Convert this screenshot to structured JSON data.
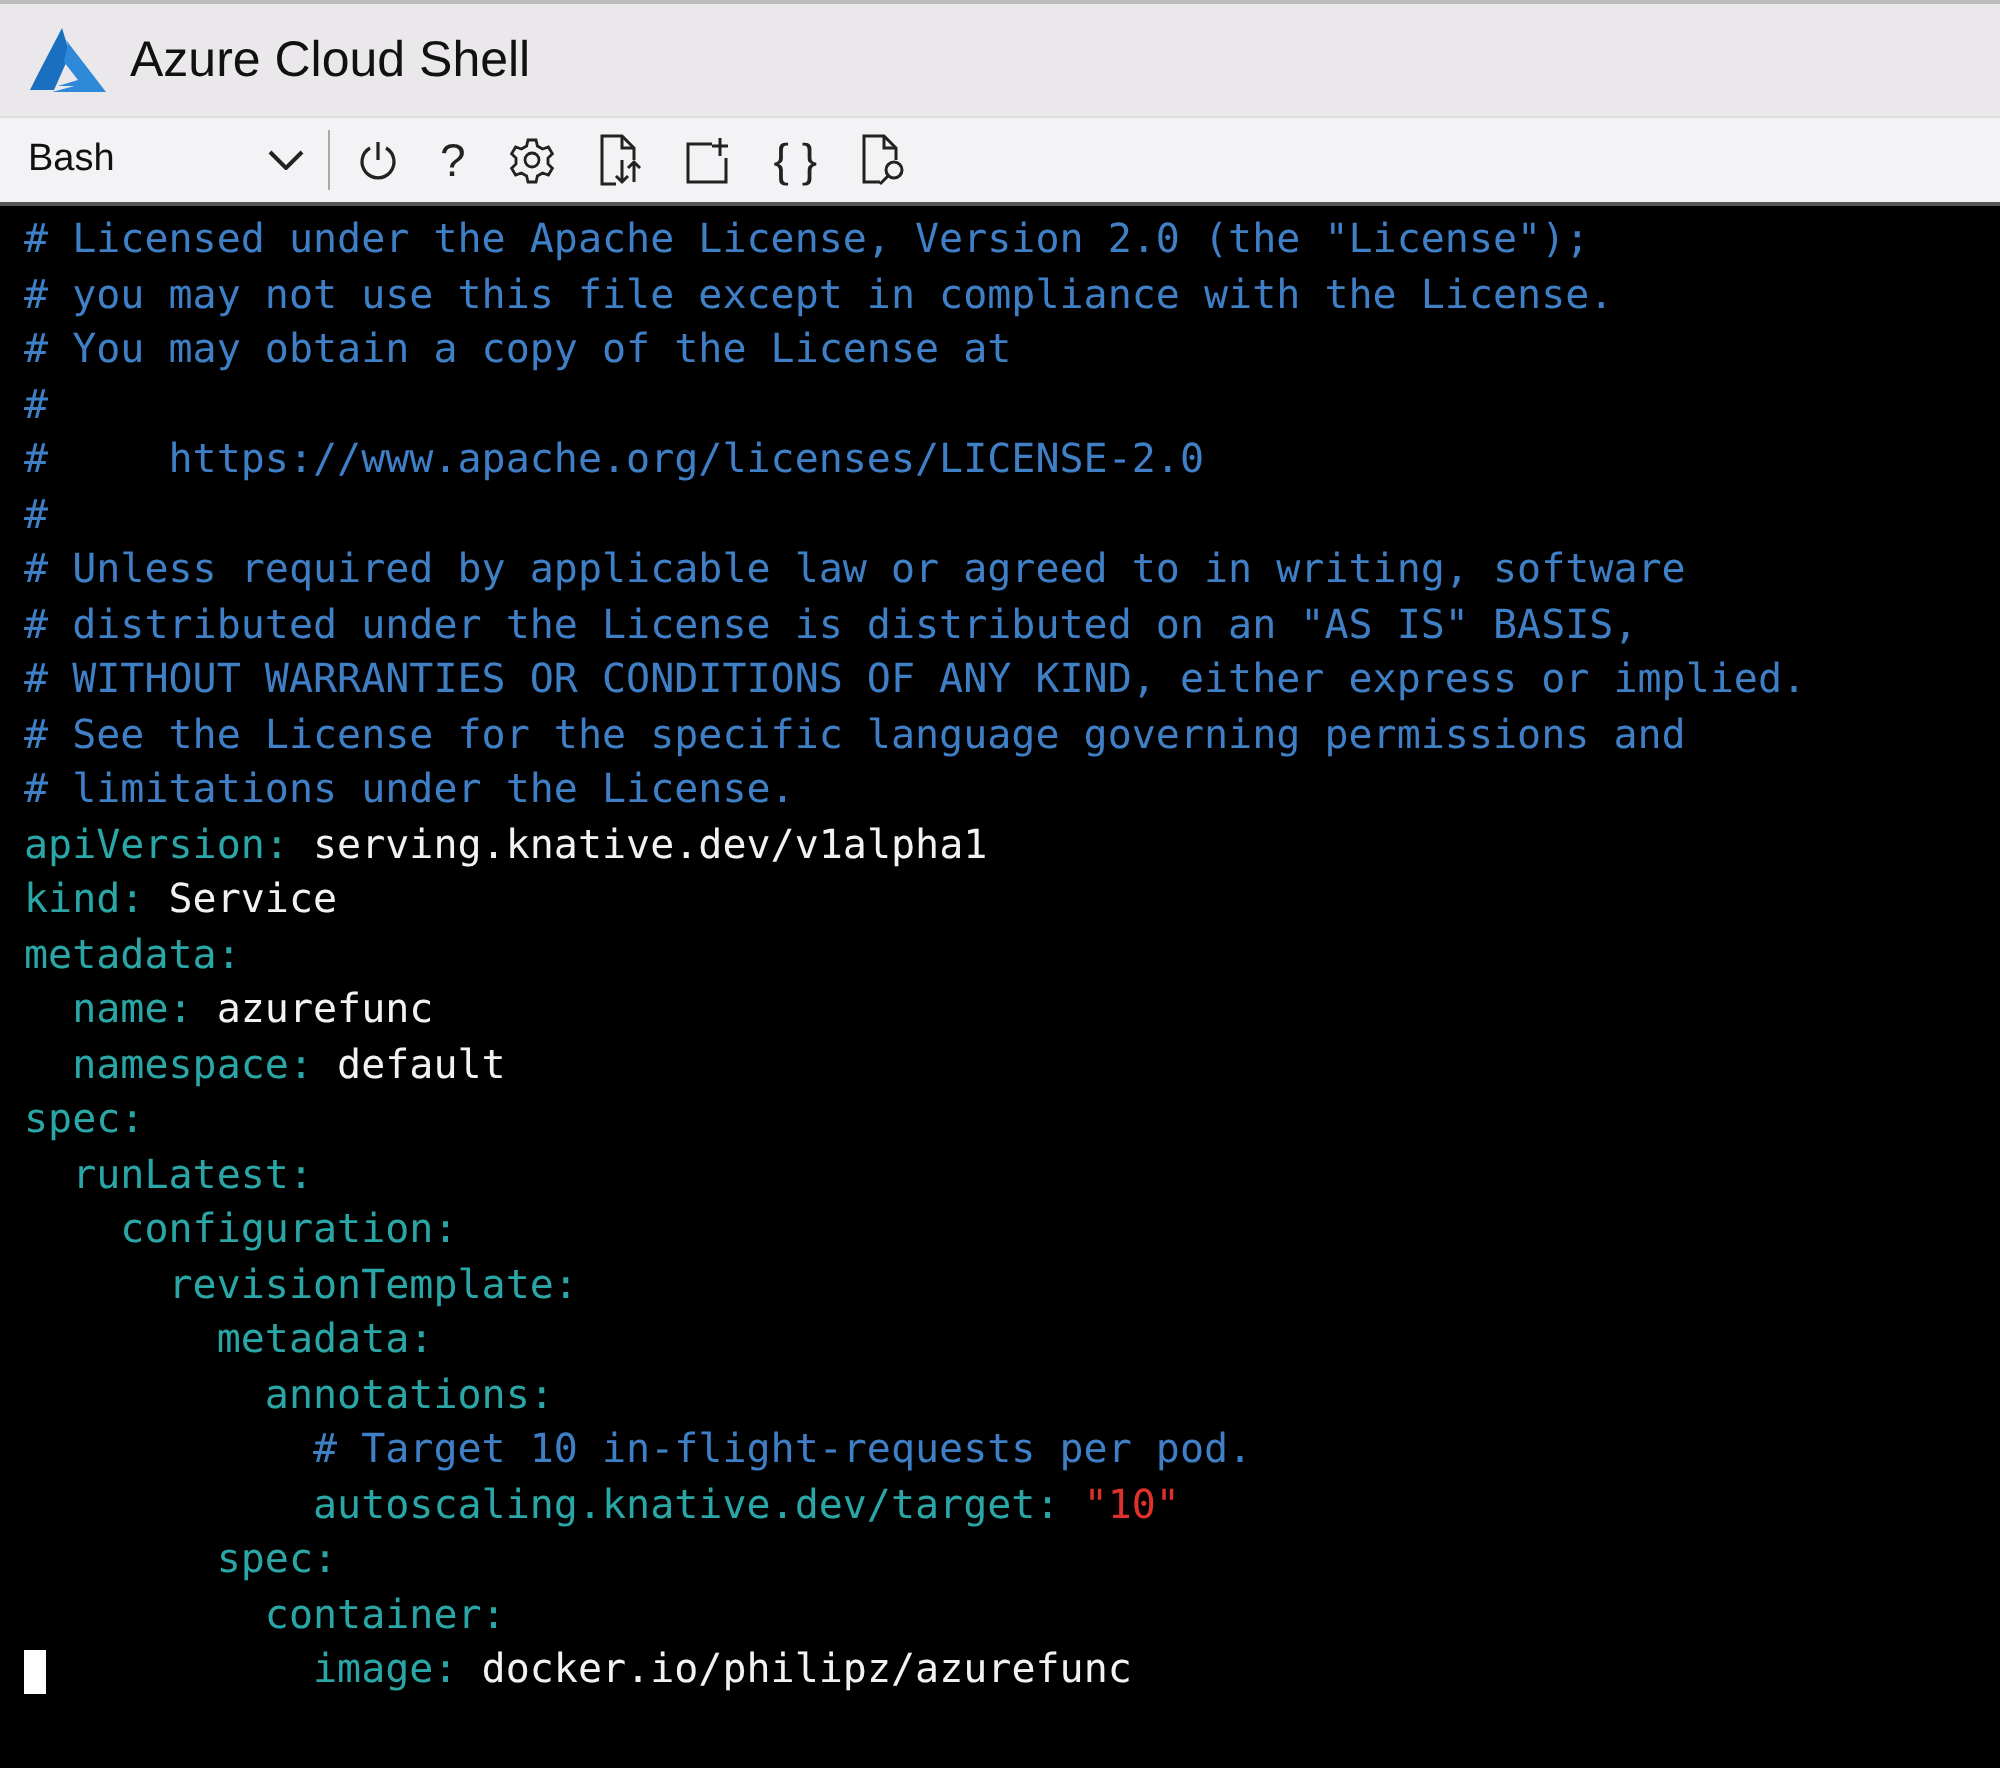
{
  "window": {
    "title": "Azure Cloud Shell"
  },
  "toolbar": {
    "shell_selector": {
      "value": "Bash"
    },
    "help_button": "?",
    "editor_button": "{ }"
  },
  "terminal": {
    "lines": [
      {
        "kind": "comment",
        "text": "# Licensed under the Apache License, Version 2.0 (the \"License\");",
        "cursor": false
      },
      {
        "kind": "comment",
        "text": "# you may not use this file except in compliance with the License.",
        "cursor": false
      },
      {
        "kind": "comment",
        "text": "# You may obtain a copy of the License at",
        "cursor": false
      },
      {
        "kind": "comment",
        "text": "#",
        "cursor": false
      },
      {
        "kind": "comment",
        "text": "#     https://www.apache.org/licenses/LICENSE-2.0",
        "cursor": false
      },
      {
        "kind": "comment",
        "text": "#",
        "cursor": false
      },
      {
        "kind": "comment",
        "text": "# Unless required by applicable law or agreed to in writing, software",
        "cursor": false
      },
      {
        "kind": "comment",
        "text": "# distributed under the License is distributed on an \"AS IS\" BASIS,",
        "cursor": false
      },
      {
        "kind": "comment",
        "text": "# WITHOUT WARRANTIES OR CONDITIONS OF ANY KIND, either express or implied.",
        "cursor": false
      },
      {
        "kind": "comment",
        "text": "# See the License for the specific language governing permissions and",
        "cursor": false
      },
      {
        "kind": "comment",
        "text": "# limitations under the License.",
        "cursor": false
      },
      {
        "kind": "pair",
        "key": "apiVersion:",
        "value": "serving.knative.dev/v1alpha1",
        "cursor": false
      },
      {
        "kind": "pair",
        "key": "kind:",
        "value": "Service",
        "cursor": false
      },
      {
        "kind": "key",
        "key": "metadata:",
        "cursor": false
      },
      {
        "kind": "pair",
        "key": "  name:",
        "value": "azurefunc",
        "cursor": false
      },
      {
        "kind": "pair",
        "key": "  namespace:",
        "value": "default",
        "cursor": false
      },
      {
        "kind": "key",
        "key": "spec:",
        "cursor": false
      },
      {
        "kind": "key",
        "key": "  runLatest:",
        "cursor": false
      },
      {
        "kind": "key",
        "key": "    configuration:",
        "cursor": false
      },
      {
        "kind": "key",
        "key": "      revisionTemplate:",
        "cursor": false
      },
      {
        "kind": "key",
        "key": "        metadata:",
        "cursor": false
      },
      {
        "kind": "key",
        "key": "          annotations:",
        "cursor": false
      },
      {
        "kind": "comment",
        "text": "            # Target 10 in-flight-requests per pod.",
        "cursor": false
      },
      {
        "kind": "string_pair",
        "key": "            autoscaling.knative.dev/target:",
        "value": "\"10\"",
        "cursor": false
      },
      {
        "kind": "key",
        "key": "        spec:",
        "cursor": false
      },
      {
        "kind": "key",
        "key": "          container:",
        "cursor": false
      },
      {
        "kind": "pair",
        "key": "            image:",
        "value": "docker.io/philipz/azurefunc",
        "cursor": true
      }
    ]
  }
}
